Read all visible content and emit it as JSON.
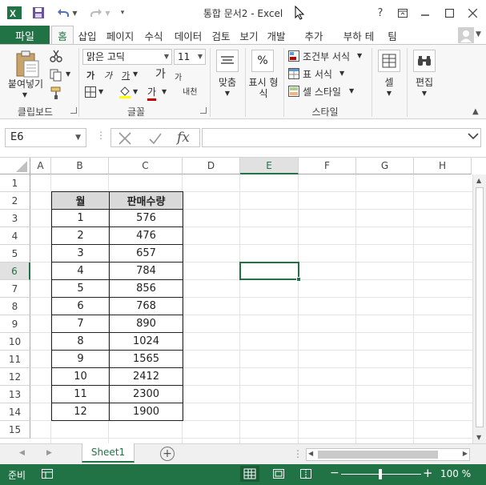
{
  "titlebar": {
    "title": "통합 문서2 - Excel",
    "help": "?"
  },
  "ribbon_tabs": {
    "file": "파일",
    "tabs": [
      "홈",
      "삽입",
      "페이지",
      "수식",
      "데이터",
      "검토",
      "보기",
      "개발",
      "추가",
      "부하 테",
      "팀"
    ]
  },
  "ribbon": {
    "clipboard": {
      "paste": "붙여넣기",
      "group": "클립보드"
    },
    "font": {
      "name": "맑은 고딕",
      "size": "11",
      "bold": "가",
      "italic": "가",
      "underline": "가",
      "grow": "가",
      "shrink": "가",
      "color": "가",
      "phonetic": "내천",
      "group": "글꼴"
    },
    "align": {
      "label": "맞춤"
    },
    "number": {
      "symbol": "%",
      "label1": "표시 형",
      "label2": "식"
    },
    "styles": {
      "conditional": "조건부 서식",
      "table": "표 서식",
      "cell": "셀 스타일",
      "group": "스타일"
    },
    "cells": {
      "label": "셀"
    },
    "edit": {
      "label": "편집"
    }
  },
  "formula_bar": {
    "name_box": "E6",
    "fx": "fx",
    "value": ""
  },
  "columns": [
    "A",
    "B",
    "C",
    "D",
    "E",
    "F",
    "G",
    "H"
  ],
  "selected_column": "E",
  "rows": [
    "1",
    "2",
    "3",
    "4",
    "5",
    "6",
    "7",
    "8",
    "9",
    "10",
    "11",
    "12",
    "13",
    "14",
    "15"
  ],
  "selected_row": "6",
  "table": {
    "headers": [
      "월",
      "판매수량"
    ],
    "rows": [
      [
        "1",
        "576"
      ],
      [
        "2",
        "476"
      ],
      [
        "3",
        "657"
      ],
      [
        "4",
        "784"
      ],
      [
        "5",
        "856"
      ],
      [
        "6",
        "768"
      ],
      [
        "7",
        "890"
      ],
      [
        "8",
        "1024"
      ],
      [
        "9",
        "1565"
      ],
      [
        "10",
        "2412"
      ],
      [
        "11",
        "2300"
      ],
      [
        "12",
        "1900"
      ]
    ]
  },
  "sheets": {
    "active": "Sheet1"
  },
  "status": {
    "mode": "준비",
    "zoom": "100 %"
  },
  "colors": {
    "accent": "#217346",
    "header_fill": "#d9d9d9"
  }
}
